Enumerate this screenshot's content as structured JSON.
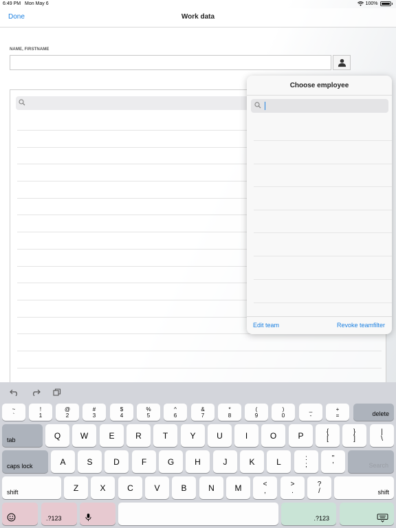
{
  "status_bar": {
    "time": "6:49 PM",
    "date": "Mon May 6",
    "battery": "100%"
  },
  "nav": {
    "done_label": "Done",
    "title": "Work data"
  },
  "form": {
    "name_label": "NAME, FIRSTNAME",
    "name_value": ""
  },
  "popover": {
    "title": "Choose employee",
    "search_value": "",
    "edit_team_label": "Edit team",
    "revoke_label": "Revoke teamfilter"
  },
  "keyboard": {
    "number_row": [
      {
        "top": "~",
        "bottom": "`"
      },
      {
        "top": "!",
        "bottom": "1"
      },
      {
        "top": "@",
        "bottom": "2"
      },
      {
        "top": "#",
        "bottom": "3"
      },
      {
        "top": "$",
        "bottom": "4"
      },
      {
        "top": "%",
        "bottom": "5"
      },
      {
        "top": "^",
        "bottom": "6"
      },
      {
        "top": "&",
        "bottom": "7"
      },
      {
        "top": "*",
        "bottom": "8"
      },
      {
        "top": "(",
        "bottom": "9"
      },
      {
        "top": ")",
        "bottom": "0"
      },
      {
        "top": "_",
        "bottom": "-"
      },
      {
        "top": "+",
        "bottom": "="
      }
    ],
    "delete_label": "delete",
    "tab_label": "tab",
    "row_q": [
      "Q",
      "W",
      "E",
      "R",
      "T",
      "Y",
      "U",
      "I",
      "O",
      "P"
    ],
    "row_q_punct": [
      {
        "top": "{",
        "bottom": "["
      },
      {
        "top": "}",
        "bottom": "]"
      },
      {
        "top": "|",
        "bottom": "\\"
      }
    ],
    "caps_label": "caps lock",
    "row_a": [
      "A",
      "S",
      "D",
      "F",
      "G",
      "H",
      "J",
      "K",
      "L"
    ],
    "row_a_punct": [
      {
        "top": ":",
        "bottom": ";"
      },
      {
        "top": "\"",
        "bottom": "'"
      }
    ],
    "search_label": "Search",
    "shift_label": "shift",
    "row_z": [
      "Z",
      "X",
      "C",
      "V",
      "B",
      "N",
      "M"
    ],
    "row_z_punct": [
      {
        "top": "<",
        "bottom": ","
      },
      {
        "top": ">",
        "bottom": "."
      },
      {
        "top": "?",
        "bottom": "/"
      }
    ],
    "numbers_label": ".?123"
  }
}
